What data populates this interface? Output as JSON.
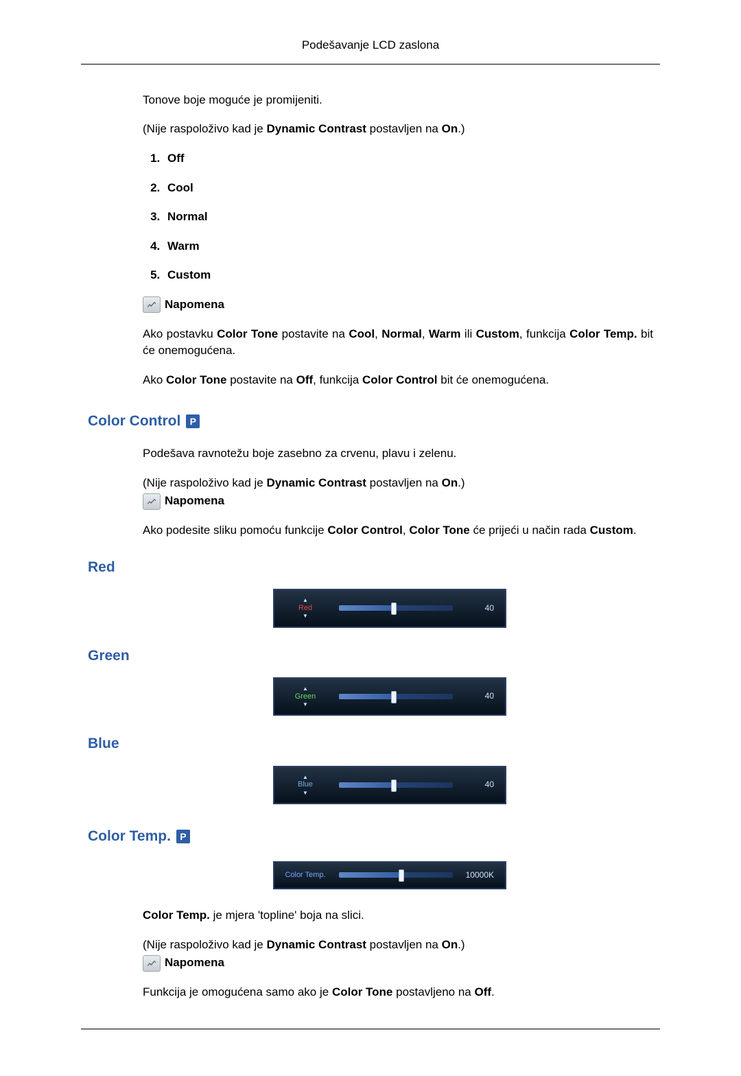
{
  "header": {
    "title": "Podešavanje LCD zaslona"
  },
  "intro": {
    "line1": "Tonove boje moguće je promijeniti.",
    "line2_pre": "(Nije raspoloživo kad je ",
    "line2_b1": "Dynamic Contrast",
    "line2_mid": " postavljen na ",
    "line2_b2": "On",
    "line2_post": ".)"
  },
  "options": {
    "items": [
      "Off",
      "Cool",
      "Normal",
      "Warm",
      "Custom"
    ]
  },
  "note_label": "Napomena",
  "note1": {
    "p1_pre": "Ako postavku ",
    "p1_b1": "Color Tone",
    "p1_mid1": " postavite na ",
    "p1_b2": "Cool",
    "p1_sep1": ", ",
    "p1_b3": "Normal",
    "p1_sep2": ", ",
    "p1_b4": "Warm",
    "p1_mid2": " ili ",
    "p1_b5": "Custom",
    "p1_mid3": ", funkcija ",
    "p1_b6": "Color Temp.",
    "p1_post": " bit će onemogućena.",
    "p2_pre": "Ako ",
    "p2_b1": "Color Tone",
    "p2_mid1": " postavite na ",
    "p2_b2": "Off",
    "p2_mid2": ", funkcija ",
    "p2_b3": "Color Control",
    "p2_post": " bit će onemogućena."
  },
  "color_control": {
    "title": "Color Control",
    "badge": "P",
    "desc": "Podešava ravnotežu boje zasebno za crvenu, plavu i zelenu.",
    "na_pre": "(Nije raspoloživo kad je ",
    "na_b1": "Dynamic Contrast",
    "na_mid": " postavljen na ",
    "na_b2": "On",
    "na_post": ".)",
    "note_p_pre": "Ako podesite sliku pomoću funkcije ",
    "note_p_b1": "Color Control",
    "note_p_sep": ", ",
    "note_p_b2": "Color Tone",
    "note_p_mid": " će prijeći u način rada ",
    "note_p_b3": "Custom",
    "note_p_post": "."
  },
  "sliders": {
    "red": {
      "title": "Red",
      "label": "Red",
      "value": "40"
    },
    "green": {
      "title": "Green",
      "label": "Green",
      "value": "40"
    },
    "blue": {
      "title": "Blue",
      "label": "Blue",
      "value": "40"
    }
  },
  "color_temp": {
    "title": "Color Temp.",
    "badge": "P",
    "slider_label": "Color Temp.",
    "slider_value": "10000K",
    "desc_b": "Color Temp.",
    "desc_rest": " je mjera 'topline' boja na slici.",
    "na_pre": "(Nije raspoloživo kad je ",
    "na_b1": "Dynamic Contrast",
    "na_mid": " postavljen na ",
    "na_b2": "On",
    "na_post": ".)",
    "note_p_pre": "Funkcija je omogućena samo ako je ",
    "note_p_b1": "Color Tone",
    "note_p_mid": " postavljeno na ",
    "note_p_b2": "Off",
    "note_p_post": "."
  }
}
